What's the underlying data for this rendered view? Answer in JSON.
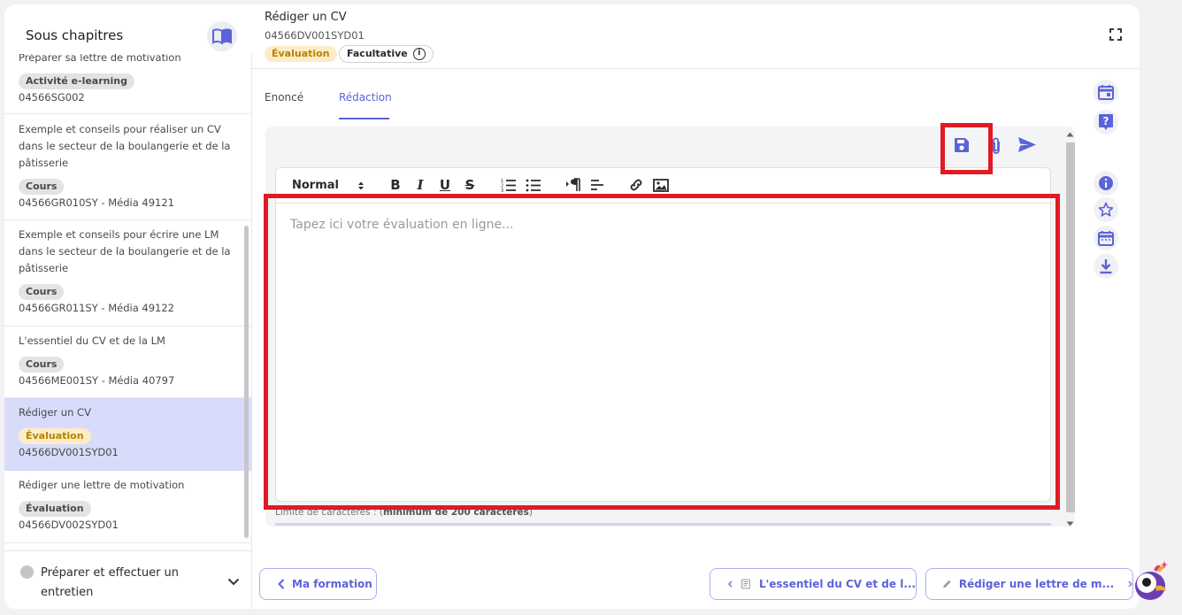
{
  "sidebar": {
    "title": "Sous chapitres",
    "items": [
      {
        "title": "Préparer sa lettre de motivation",
        "badge": "Activité e-learning",
        "code": "04566SG002",
        "badge_type": "neutral"
      },
      {
        "title": "Exemple et conseils pour réaliser un CV dans le secteur de la boulangerie et de la pâtisserie",
        "badge": "Cours",
        "code": "04566GR010SY - Média 49121",
        "badge_type": "neutral"
      },
      {
        "title": "Exemple et conseils pour écrire une LM dans le secteur de la boulangerie et de la pâtisserie",
        "badge": "Cours",
        "code": "04566GR011SY - Média 49122",
        "badge_type": "neutral"
      },
      {
        "title": "L'essentiel du CV et de la LM",
        "badge": "Cours",
        "code": "04566ME001SY - Média 40797",
        "badge_type": "neutral"
      },
      {
        "title": "Rédiger un CV",
        "badge": "Évaluation",
        "code": "04566DV001SYD01",
        "badge_type": "eval",
        "active": true
      },
      {
        "title": "Rédiger une lettre de motivation",
        "badge": "Évaluation",
        "code": "04566DV002SYD01",
        "badge_type": "neutral"
      }
    ],
    "footer": {
      "label": "Préparer et effectuer un entretien"
    }
  },
  "header": {
    "title": "Rédiger un CV",
    "code": "04566DV001SYD01",
    "badge_eval": "Évaluation",
    "badge_optional": "Facultative",
    "info_glyph": "i"
  },
  "tabs": {
    "enonce": "Enoncé",
    "redaction": "Rédaction"
  },
  "editor": {
    "format_select": "Normal",
    "placeholder": "Tapez ici votre évaluation en ligne...",
    "limit_prefix": "Limite de caractères : (",
    "limit_bold": "minimum de 200 caractères",
    "limit_suffix": ")"
  },
  "navigation": {
    "back": "Ma formation",
    "prev": "L'essentiel du CV et de l...",
    "next": "Rédiger une lettre de m..."
  },
  "colors": {
    "accent": "#5b63d8",
    "highlight": "#e01b24",
    "eval_badge": "#fcedc8"
  }
}
